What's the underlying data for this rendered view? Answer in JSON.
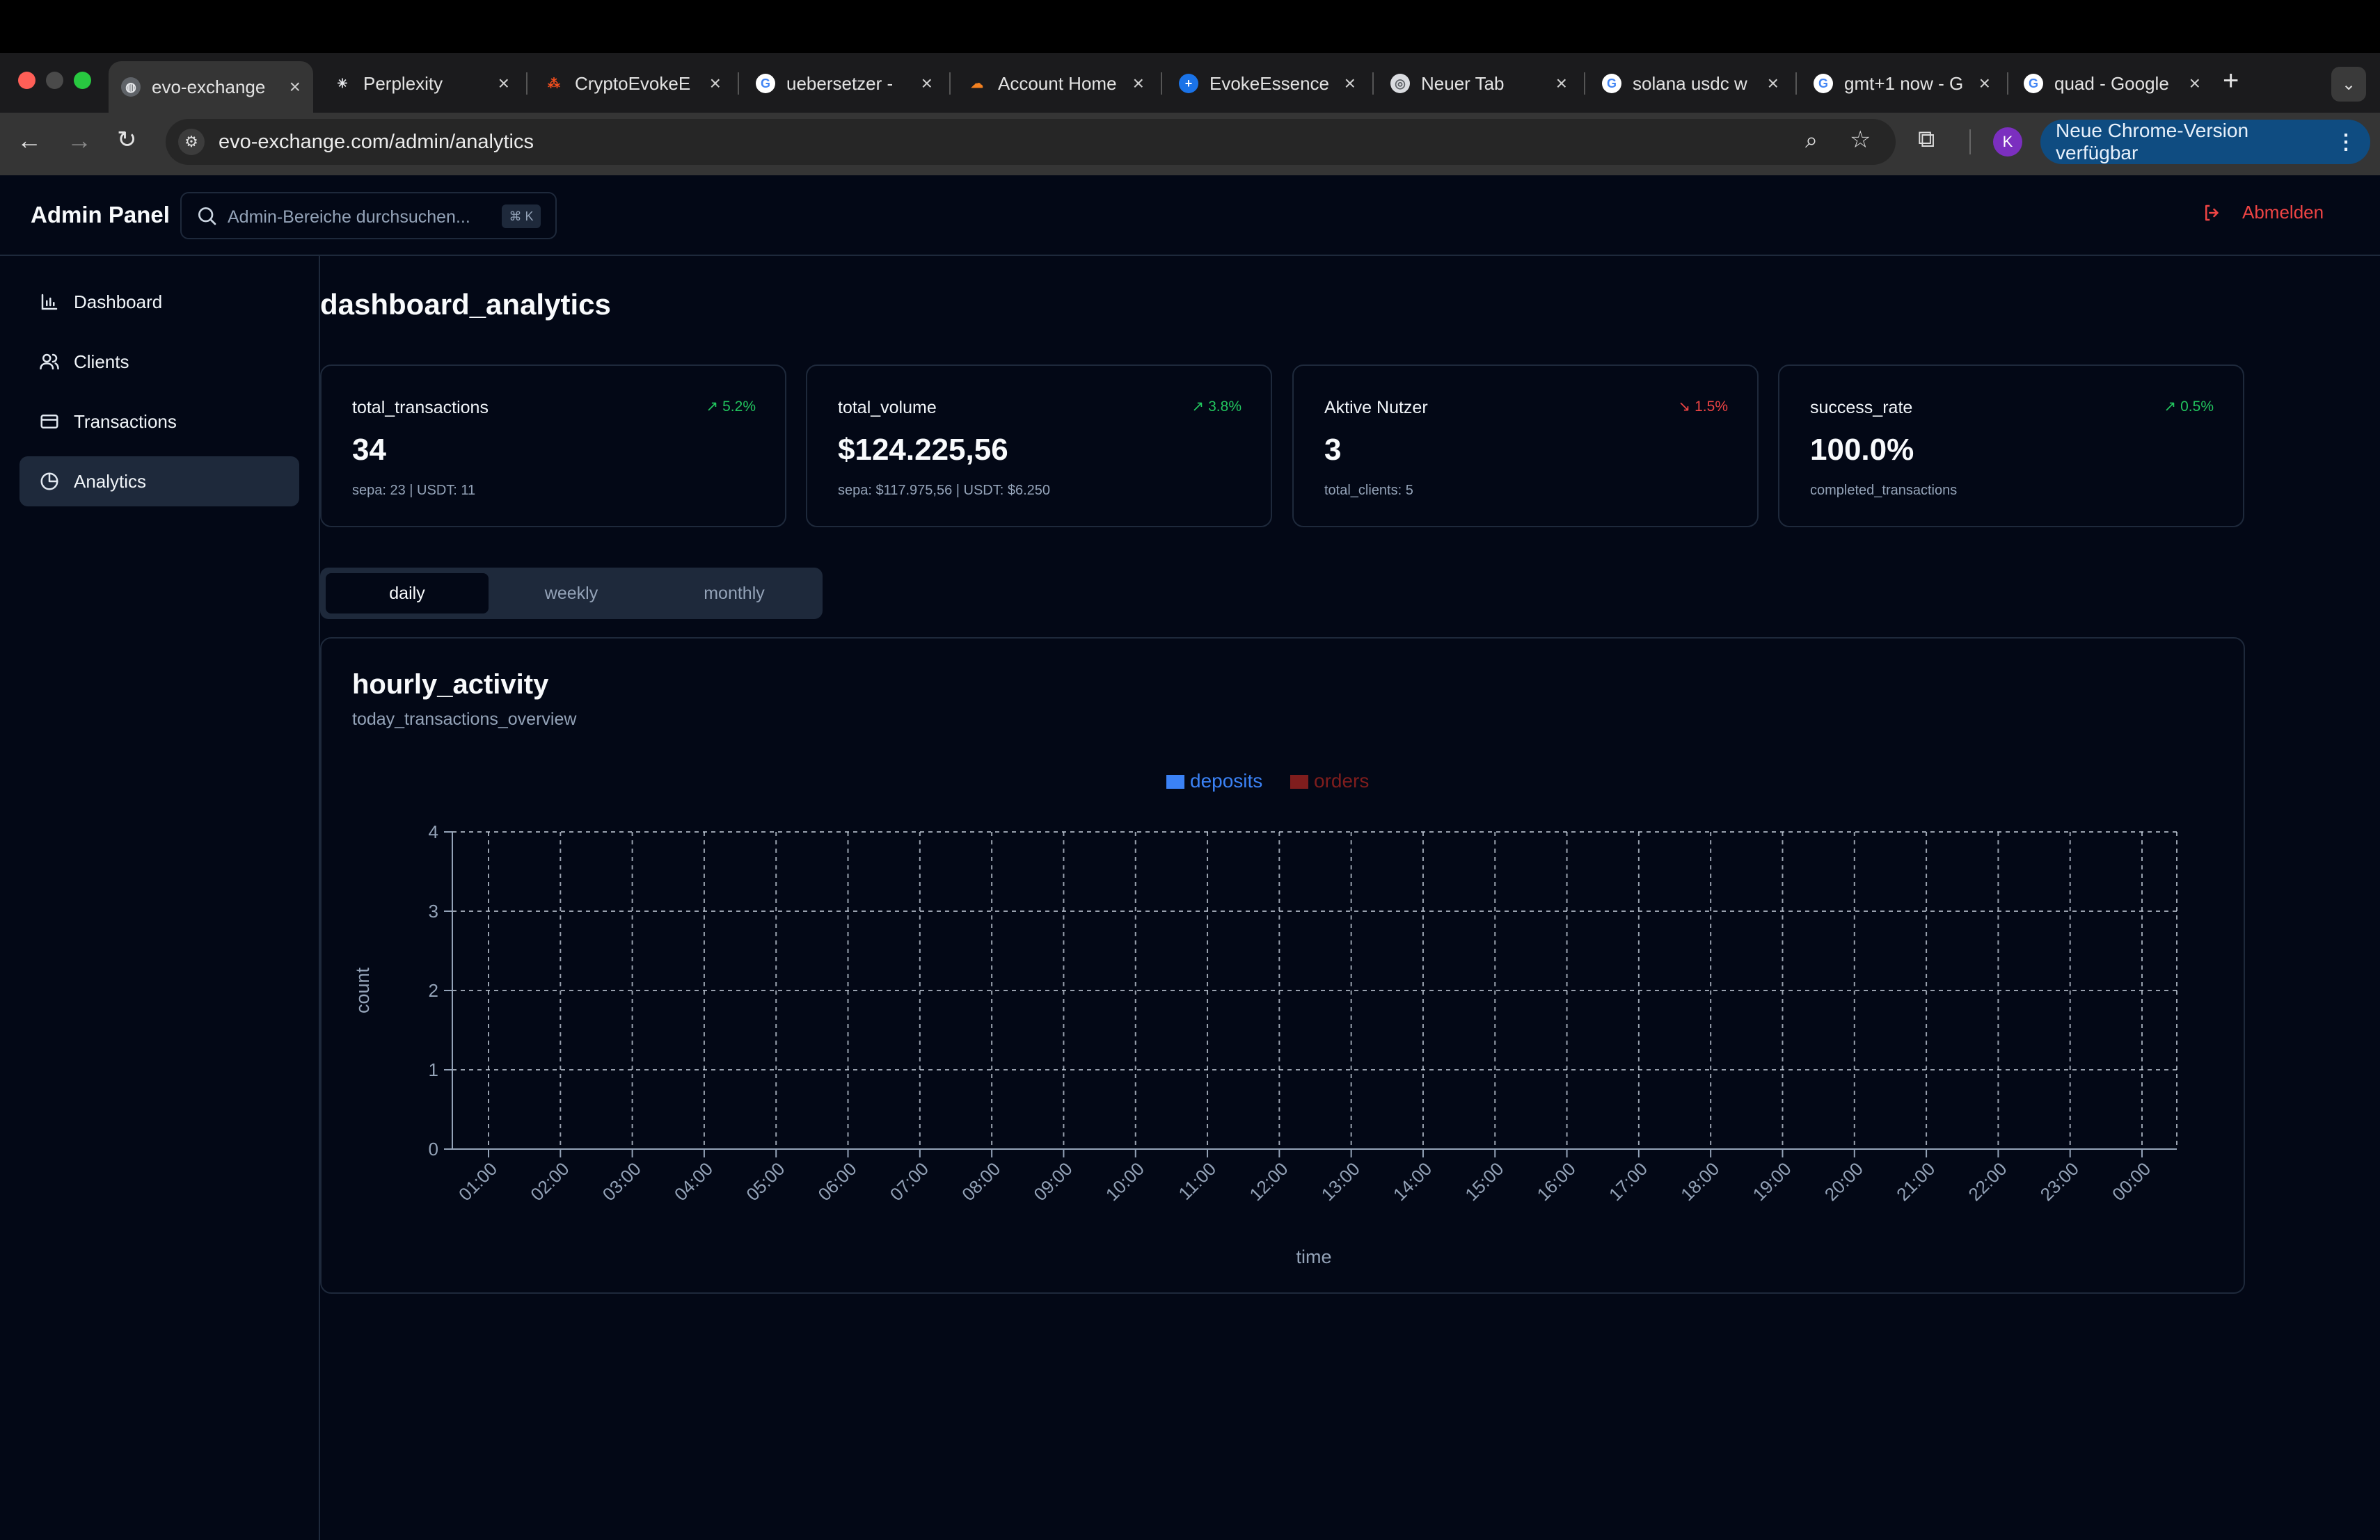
{
  "browser": {
    "tabs": [
      {
        "title": "evo-exchange",
        "icon": "globe-icon",
        "active": true
      },
      {
        "title": "Perplexity",
        "icon": "perplexity-icon",
        "active": false
      },
      {
        "title": "CryptoEvokeE",
        "icon": "figma-icon",
        "active": false
      },
      {
        "title": "uebersetzer -",
        "icon": "google-icon",
        "active": false
      },
      {
        "title": "Account Home",
        "icon": "cloudflare-icon",
        "active": false
      },
      {
        "title": "EvokeEssence",
        "icon": "plus-circle-icon",
        "active": false
      },
      {
        "title": "Neuer Tab",
        "icon": "chrome-icon",
        "active": false
      },
      {
        "title": "solana usdc w",
        "icon": "google-icon",
        "active": false
      },
      {
        "title": "gmt+1 now - G",
        "icon": "google-icon",
        "active": false
      },
      {
        "title": "quad - Google",
        "icon": "google-icon",
        "active": false
      }
    ],
    "url": "evo-exchange.com/admin/analytics",
    "profile_initial": "K",
    "update_label": "Neue Chrome-Version verfügbar"
  },
  "header": {
    "brand": "Admin Panel",
    "search_placeholder": "Admin-Bereiche durchsuchen...",
    "search_shortcut": "⌘ K",
    "logout_label": "Abmelden"
  },
  "sidebar": {
    "items": [
      {
        "label": "Dashboard",
        "icon": "bar-chart-icon",
        "active": false
      },
      {
        "label": "Clients",
        "icon": "users-icon",
        "active": false
      },
      {
        "label": "Transactions",
        "icon": "credit-card-icon",
        "active": false
      },
      {
        "label": "Analytics",
        "icon": "pie-chart-icon",
        "active": true
      }
    ]
  },
  "page": {
    "title": "dashboard_analytics"
  },
  "stats": [
    {
      "label": "total_transactions",
      "value": "34",
      "sub": "sepa: 23 | USDT: 11",
      "trend": "5.2%",
      "direction": "up"
    },
    {
      "label": "total_volume",
      "value": "$124.225,56",
      "sub": "sepa: $117.975,56 | USDT: $6.250",
      "trend": "3.8%",
      "direction": "up"
    },
    {
      "label": "Aktive Nutzer",
      "value": "3",
      "sub": "total_clients: 5",
      "trend": "1.5%",
      "direction": "down"
    },
    {
      "label": "success_rate",
      "value": "100.0%",
      "sub": "completed_transactions",
      "trend": "0.5%",
      "direction": "up"
    }
  ],
  "period_tabs": {
    "options": [
      "daily",
      "weekly",
      "monthly"
    ],
    "selected": "daily"
  },
  "chart_card": {
    "title": "hourly_activity",
    "subtitle": "today_transactions_overview"
  },
  "colors": {
    "deposits": "#3b82f6",
    "orders": "#7f1d1d",
    "trend_up": "#22c55e",
    "trend_down": "#ef4444",
    "logout": "#ef4444"
  },
  "chart_data": {
    "type": "line",
    "x": [
      "01:00",
      "02:00",
      "03:00",
      "04:00",
      "05:00",
      "06:00",
      "07:00",
      "08:00",
      "09:00",
      "10:00",
      "11:00",
      "12:00",
      "13:00",
      "14:00",
      "15:00",
      "16:00",
      "17:00",
      "18:00",
      "19:00",
      "20:00",
      "21:00",
      "22:00",
      "23:00",
      "00:00"
    ],
    "series": [
      {
        "name": "deposits",
        "values": [
          0,
          0,
          0,
          0,
          0,
          0,
          0,
          0,
          0,
          0,
          0,
          0,
          0,
          0,
          0,
          0,
          0,
          0,
          0,
          0,
          0,
          0,
          0,
          0
        ]
      },
      {
        "name": "orders",
        "values": [
          0,
          0,
          0,
          0,
          0,
          0,
          0,
          0,
          0,
          0,
          0,
          0,
          0,
          0,
          0,
          0,
          0,
          0,
          0,
          0,
          0,
          0,
          0,
          0
        ]
      }
    ],
    "xlabel": "time",
    "ylabel": "count",
    "ylim": [
      0,
      4
    ],
    "yticks": [
      0,
      1,
      2,
      3,
      4
    ],
    "grid": true,
    "legend_position": "top-center"
  }
}
